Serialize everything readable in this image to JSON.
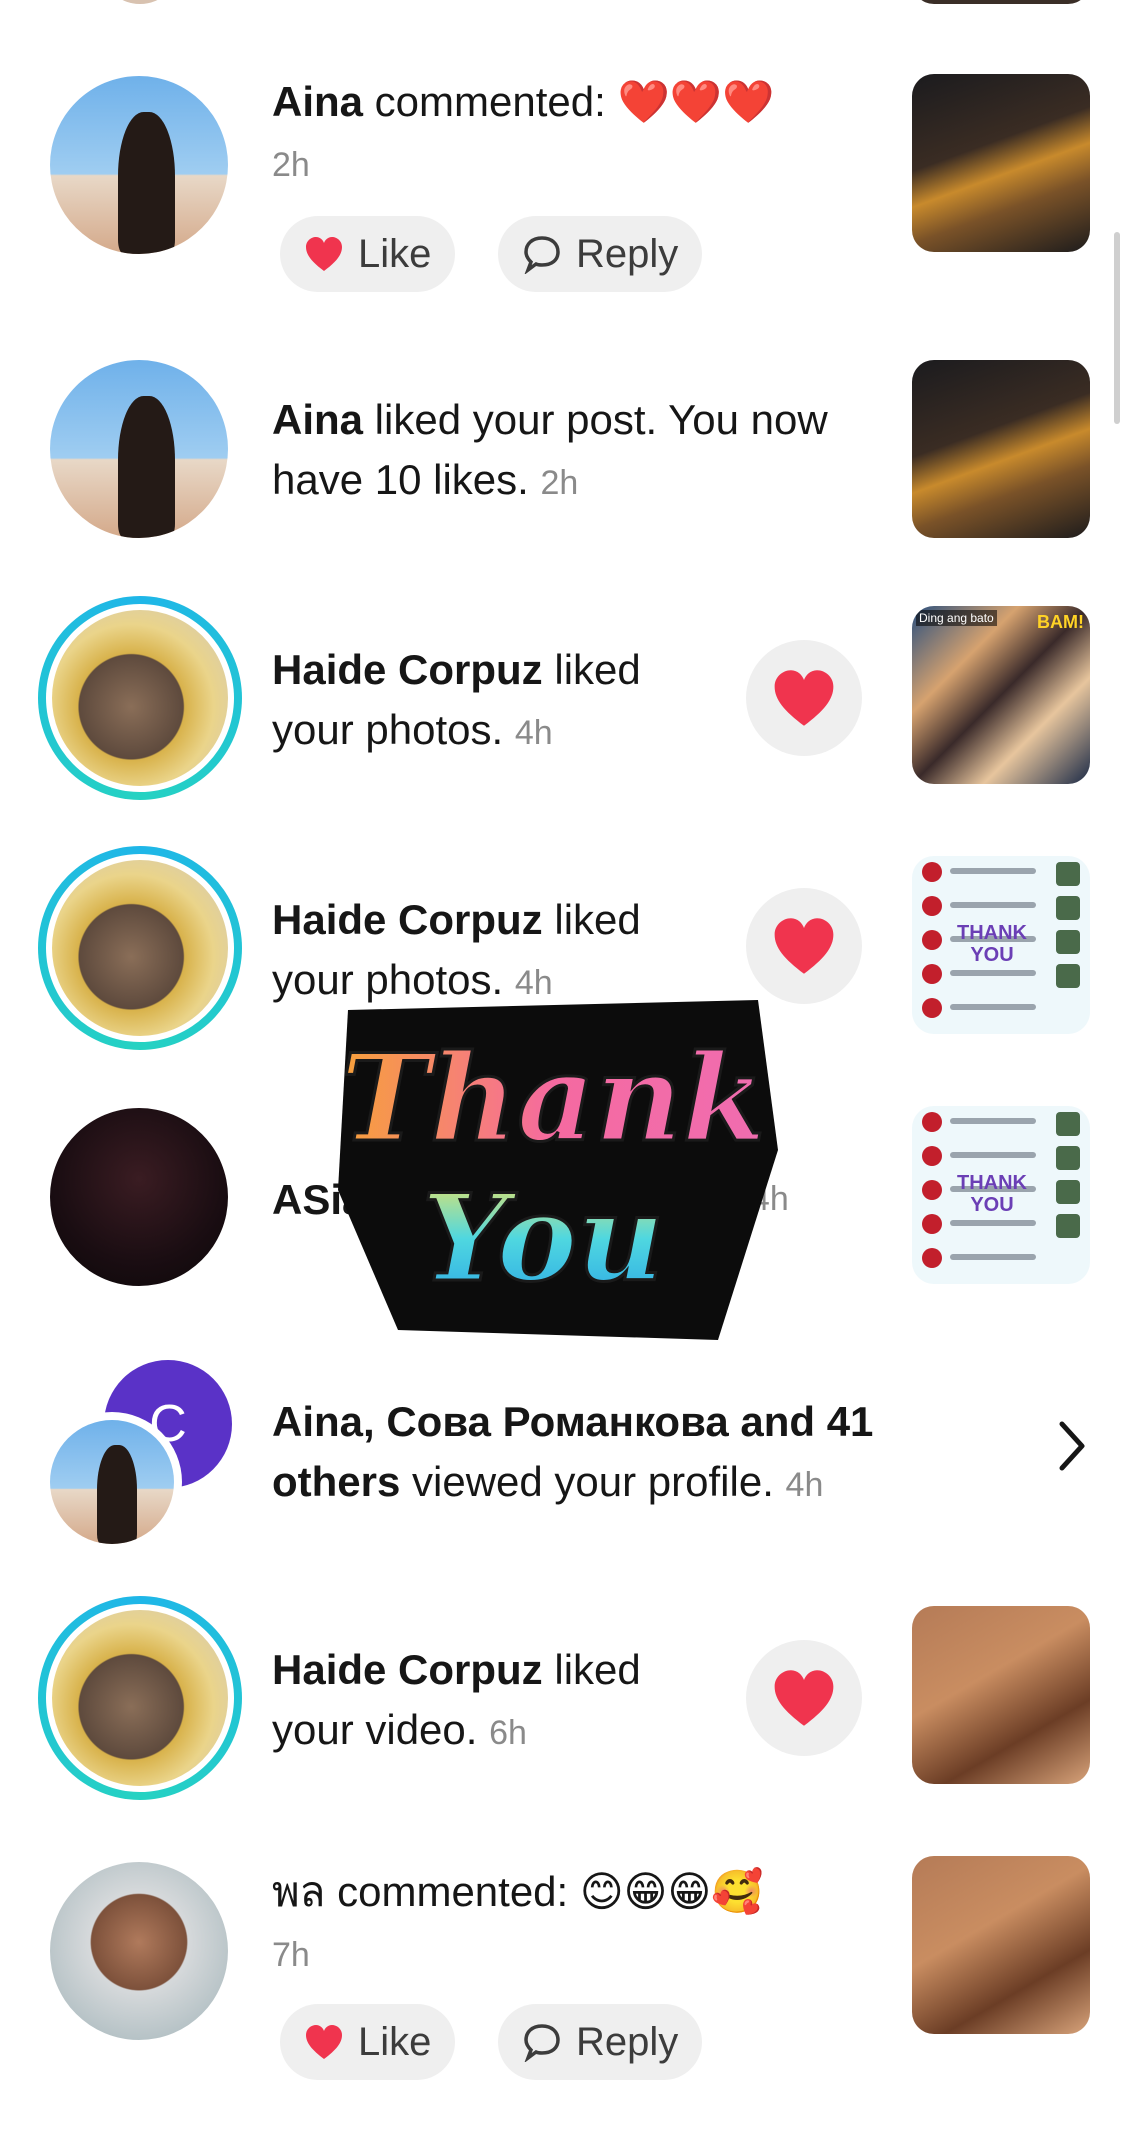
{
  "notifications": [
    {
      "user": "Aina",
      "action": " commented: ",
      "emoji": "❤️❤️❤️",
      "time": "2h",
      "like_label": "Like",
      "reply_label": "Reply"
    },
    {
      "user": "Aina",
      "action_line1": " liked your post. You now",
      "action_line2": "have 10 likes.",
      "time": "2h"
    },
    {
      "user": "Haide Corpuz",
      "action_line1": " liked",
      "action_line2": "your photos.",
      "time": "4h"
    },
    {
      "user": "Haide Corpuz",
      "action_line1": " liked",
      "action_line2": "your photos.",
      "time": "4h"
    },
    {
      "user": "ASia",
      "time": "4h"
    },
    {
      "users_line1": "Aina, Сова Романкова and 41",
      "users_line2": "others",
      "action": " viewed your profile.",
      "time": "4h",
      "avatar_letter": "C"
    },
    {
      "user": "Haide Corpuz",
      "action_line1": " liked",
      "action_line2": "your video.",
      "time": "6h"
    },
    {
      "user": "พล",
      "action": " commented: ",
      "emoji": "😊😁😁🥰",
      "time": "7h",
      "like_label": "Like",
      "reply_label": "Reply"
    }
  ],
  "sticker": {
    "line1": "Thank",
    "line2": "You"
  },
  "thumbnail_text": {
    "list_overlay": "THANK YOU",
    "comic_caption": "Ding ang bato",
    "comic_bam": "BAM!"
  },
  "colors": {
    "like_heart": "#f0344e",
    "ring": "#1fb6e8",
    "avatar_c_bg": "#5a32c7"
  }
}
